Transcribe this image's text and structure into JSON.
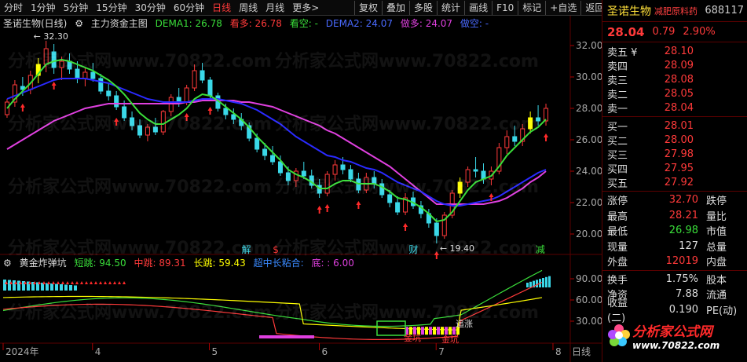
{
  "toolbar": {
    "timeframes": [
      "分时",
      "1分钟",
      "5分钟",
      "15分钟",
      "30分钟",
      "60分钟",
      "日线",
      "周线",
      "月线",
      "更多>"
    ],
    "active_timeframe": "日线",
    "buttons": [
      "复权",
      "叠加",
      "多股",
      "统计",
      "画线",
      "F10",
      "标记",
      "+自选",
      "返回"
    ]
  },
  "main_legend": {
    "stock": "圣诺生物(日线)",
    "indicator": "主力资金主图",
    "dema1": "DEMA1: 26.78",
    "kanduo": "看多: 26.78",
    "kankong": "看空: -",
    "dema2": "DEMA2: 24.07",
    "zuoduo": "做多: 24.07",
    "zuokong": "做空: -"
  },
  "sub_legend": {
    "name": "黄金炸弹坑",
    "short": "短跳: 94.50",
    "mid": "中跳: 89.31",
    "long": "长跳: 59.43",
    "combo": "超中长粘合:",
    "bottom": "底: : 6.00"
  },
  "price_axis": [
    "32.00",
    "30.00",
    "28.00",
    "26.00",
    "24.00",
    "22.00",
    "20.00"
  ],
  "sub_axis": [
    "90.00",
    "60.00",
    "30.00"
  ],
  "date_axis": [
    "2024年",
    "4",
    "5",
    "6",
    "7",
    "8"
  ],
  "annotations": {
    "high": "32.30",
    "low": "19.40",
    "marks": [
      "解",
      "$",
      "财",
      "减"
    ],
    "sub_marks": [
      "追涨",
      "金坑",
      "金坑"
    ]
  },
  "date_right_label": "日线",
  "watermark": "分析家公式网www.70822.com",
  "quote": {
    "name": "圣诺生物",
    "tag": "减肥原料药",
    "code": "688117",
    "price": "28.04",
    "change": "0.79",
    "change_pct": "2.90%",
    "asks": [
      {
        "label": "卖五 ¥",
        "price": "28.10"
      },
      {
        "label": "卖四",
        "price": "28.09"
      },
      {
        "label": "卖三",
        "price": "28.08"
      },
      {
        "label": "卖二",
        "price": "28.05"
      },
      {
        "label": "卖一",
        "price": "28.04"
      }
    ],
    "bids": [
      {
        "label": "买一",
        "price": "28.01"
      },
      {
        "label": "买二",
        "price": "28.00"
      },
      {
        "label": "买三",
        "price": "27.98"
      },
      {
        "label": "买四",
        "price": "27.95"
      },
      {
        "label": "买五",
        "price": "27.92"
      }
    ],
    "stats1": [
      {
        "label": "涨停",
        "value": "32.70",
        "color": "#ff3a3a",
        "label2": "跌停"
      },
      {
        "label": "最高",
        "value": "28.21",
        "color": "#ff3a3a",
        "label2": "量比"
      },
      {
        "label": "最低",
        "value": "26.98",
        "color": "#3ade3a",
        "label2": "市值"
      },
      {
        "label": "现量",
        "value": "127",
        "color": "#dddddd",
        "label2": "总量"
      },
      {
        "label": "外盘",
        "value": "12019",
        "color": "#ff3a3a",
        "label2": "内盘"
      }
    ],
    "stats2": [
      {
        "label": "换手",
        "value": "1.75%",
        "color": "#dddddd",
        "label2": "股本"
      },
      {
        "label": "净资",
        "value": "7.88",
        "color": "#dddddd",
        "label2": "流通"
      },
      {
        "label": "收益(二)",
        "value": "0.190",
        "color": "#dddddd",
        "label2": "PE(动)"
      }
    ]
  },
  "logo": {
    "text": "分析家公式网",
    "url": "www.70822.com"
  },
  "colors": {
    "up": "#ff3a3a",
    "down": "#3ad8e8",
    "dema1": "#3ade3a",
    "dema2": "#2a2aff",
    "magenta": "#e040e0",
    "yellow": "#ffff00"
  },
  "chart_data": {
    "type": "candlestick",
    "ylim": [
      19,
      33
    ],
    "candles": [
      [
        27.6,
        28.6,
        27.4,
        28.4
      ],
      [
        28.4,
        29.8,
        28.1,
        29.5
      ],
      [
        29.4,
        30.0,
        28.8,
        29.2
      ],
      [
        29.2,
        30.4,
        28.9,
        30.1
      ],
      [
        30.1,
        31.2,
        29.6,
        30.8
      ],
      [
        30.8,
        32.3,
        30.3,
        31.8
      ],
      [
        31.6,
        32.1,
        30.2,
        30.6
      ],
      [
        30.6,
        31.3,
        29.8,
        31.0
      ],
      [
        31.0,
        31.5,
        30.2,
        30.5
      ],
      [
        30.5,
        31.0,
        29.6,
        29.9
      ],
      [
        29.9,
        30.6,
        29.4,
        30.3
      ],
      [
        30.3,
        30.9,
        29.7,
        29.9
      ],
      [
        29.9,
        30.2,
        28.9,
        29.1
      ],
      [
        29.1,
        29.6,
        28.5,
        28.8
      ],
      [
        28.8,
        29.1,
        27.9,
        28.1
      ],
      [
        28.1,
        28.5,
        27.2,
        27.4
      ],
      [
        27.4,
        27.8,
        26.6,
        26.9
      ],
      [
        26.9,
        27.3,
        26.1,
        26.3
      ],
      [
        26.3,
        27.0,
        25.9,
        26.8
      ],
      [
        26.8,
        27.4,
        26.3,
        26.5
      ],
      [
        26.5,
        27.9,
        26.3,
        27.8
      ],
      [
        27.8,
        28.9,
        27.5,
        28.7
      ],
      [
        28.7,
        29.3,
        28.1,
        28.4
      ],
      [
        28.4,
        29.5,
        28.2,
        29.3
      ],
      [
        29.3,
        30.8,
        29.1,
        30.4
      ],
      [
        30.4,
        30.9,
        29.6,
        29.8
      ],
      [
        29.8,
        30.0,
        28.6,
        28.8
      ],
      [
        28.8,
        29.0,
        27.8,
        28.0
      ],
      [
        28.0,
        28.3,
        27.3,
        27.6
      ],
      [
        27.6,
        28.0,
        27.0,
        27.3
      ],
      [
        27.3,
        27.7,
        26.6,
        26.9
      ],
      [
        26.9,
        27.1,
        25.9,
        26.1
      ],
      [
        26.1,
        26.4,
        25.2,
        25.4
      ],
      [
        25.4,
        25.8,
        24.7,
        25.0
      ],
      [
        25.0,
        25.6,
        24.4,
        24.6
      ],
      [
        24.6,
        25.0,
        23.7,
        23.9
      ],
      [
        23.9,
        24.3,
        23.1,
        23.4
      ],
      [
        23.4,
        24.2,
        23.0,
        24.0
      ],
      [
        24.0,
        24.6,
        23.5,
        23.7
      ],
      [
        23.7,
        24.1,
        22.9,
        23.1
      ],
      [
        23.1,
        23.5,
        22.3,
        22.6
      ],
      [
        22.6,
        24.0,
        22.4,
        23.8
      ],
      [
        23.8,
        24.7,
        23.4,
        24.4
      ],
      [
        24.4,
        24.9,
        23.8,
        24.1
      ],
      [
        24.1,
        24.4,
        23.3,
        23.5
      ],
      [
        23.5,
        23.9,
        22.6,
        22.8
      ],
      [
        22.8,
        23.9,
        22.6,
        23.6
      ],
      [
        23.6,
        24.0,
        22.9,
        23.2
      ],
      [
        23.2,
        23.5,
        22.3,
        22.5
      ],
      [
        22.5,
        22.8,
        21.7,
        22.0
      ],
      [
        22.0,
        22.4,
        21.2,
        21.4
      ],
      [
        21.4,
        22.6,
        21.2,
        22.3
      ],
      [
        22.3,
        22.7,
        21.6,
        21.8
      ],
      [
        21.8,
        22.1,
        21.0,
        21.3
      ],
      [
        21.3,
        21.6,
        20.4,
        20.7
      ],
      [
        20.7,
        21.0,
        19.4,
        19.9
      ],
      [
        19.9,
        21.4,
        19.7,
        21.2
      ],
      [
        21.2,
        22.8,
        21.0,
        22.6
      ],
      [
        22.6,
        23.6,
        22.3,
        23.3
      ],
      [
        23.3,
        24.3,
        23.0,
        24.1
      ],
      [
        24.1,
        24.9,
        23.6,
        24.0
      ],
      [
        24.0,
        24.5,
        23.2,
        23.5
      ],
      [
        23.5,
        24.3,
        23.1,
        24.0
      ],
      [
        24.0,
        25.8,
        23.8,
        25.5
      ],
      [
        25.5,
        26.6,
        25.1,
        26.2
      ],
      [
        26.2,
        26.9,
        25.6,
        25.9
      ],
      [
        25.9,
        27.0,
        25.6,
        26.7
      ],
      [
        26.7,
        27.8,
        26.4,
        27.4
      ],
      [
        27.4,
        28.2,
        26.9,
        27.2
      ],
      [
        27.2,
        28.3,
        26.9,
        28.0
      ]
    ],
    "dema1": [
      28.0,
      28.6,
      29.1,
      29.6,
      30.2,
      30.8,
      31.0,
      31.1,
      31.0,
      30.8,
      30.6,
      30.4,
      30.1,
      29.8,
      29.4,
      28.9,
      28.3,
      27.7,
      27.3,
      27.0,
      27.0,
      27.3,
      27.6,
      28.0,
      28.6,
      28.9,
      28.8,
      28.5,
      28.1,
      27.7,
      27.3,
      26.8,
      26.2,
      25.7,
      25.2,
      24.7,
      24.1,
      23.8,
      23.6,
      23.3,
      22.9,
      22.9,
      23.2,
      23.4,
      23.4,
      23.2,
      23.2,
      23.2,
      23.0,
      22.7,
      22.3,
      22.2,
      22.0,
      21.7,
      21.3,
      20.8,
      20.9,
      21.4,
      22.1,
      22.8,
      23.3,
      23.5,
      23.7,
      24.3,
      25.0,
      25.5,
      26.0,
      26.5,
      26.8,
      27.3
    ],
    "dema2": [
      28.6,
      28.8,
      29.0,
      29.2,
      29.4,
      29.6,
      29.8,
      29.9,
      29.9,
      29.9,
      29.9,
      29.8,
      29.7,
      29.6,
      29.4,
      29.2,
      29.0,
      28.8,
      28.6,
      28.5,
      28.4,
      28.4,
      28.4,
      28.4,
      28.5,
      28.6,
      28.6,
      28.6,
      28.5,
      28.4,
      28.3,
      28.1,
      27.9,
      27.6,
      27.3,
      27.0,
      26.6,
      26.2,
      25.9,
      25.6,
      25.3,
      25.0,
      24.9,
      24.7,
      24.6,
      24.4,
      24.2,
      24.1,
      23.9,
      23.6,
      23.3,
      23.1,
      22.9,
      22.7,
      22.4,
      22.1,
      21.9,
      21.8,
      21.8,
      21.9,
      22.0,
      22.1,
      22.2,
      22.4,
      22.7,
      23.0,
      23.3,
      23.6,
      23.9,
      24.1
    ],
    "ma_magenta": [
      25.4,
      25.7,
      26.0,
      26.3,
      26.6,
      26.9,
      27.2,
      27.4,
      27.6,
      27.8,
      28.0,
      28.1,
      28.2,
      28.3,
      28.3,
      28.3,
      28.3,
      28.3,
      28.3,
      28.3,
      28.3,
      28.3,
      28.3,
      28.4,
      28.4,
      28.5,
      28.5,
      28.5,
      28.5,
      28.5,
      28.4,
      28.4,
      28.3,
      28.2,
      28.1,
      27.9,
      27.7,
      27.5,
      27.3,
      27.1,
      26.9,
      26.6,
      26.4,
      26.1,
      25.8,
      25.5,
      25.2,
      24.9,
      24.6,
      24.3,
      23.9,
      23.5,
      23.1,
      22.7,
      22.3,
      21.9,
      21.9,
      21.9,
      21.9,
      21.9,
      21.9,
      21.9,
      22.0,
      22.1,
      22.3,
      22.6,
      22.9,
      23.3,
      23.6,
      24.0
    ]
  }
}
